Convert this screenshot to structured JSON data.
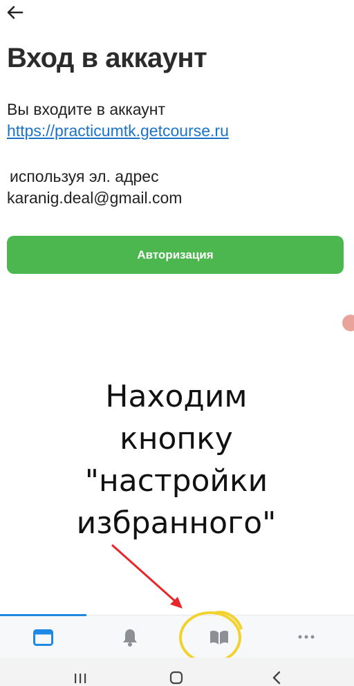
{
  "header": {
    "back_icon": "arrow-left-icon",
    "title": "Вход в аккаунт"
  },
  "info": {
    "line1": "Вы входите в аккаунт",
    "link": "https://practicumtk.getcourse.ru",
    "line2": "используя эл. адрес",
    "email": "karanig.deal@gmail.com"
  },
  "auth_button": {
    "label": "Авторизация",
    "color": "#4cb74f"
  },
  "annotation": {
    "lines": [
      "Находим",
      "кнопку",
      "\"настройки",
      "избранного\""
    ],
    "arrow_color": "#e8262a",
    "circle_color": "#f2d22e"
  },
  "tabbar": {
    "accent": "#1e88e5",
    "tabs": [
      {
        "icon": "browser-window-icon",
        "active": true
      },
      {
        "icon": "bell-icon",
        "active": false
      },
      {
        "icon": "book-icon",
        "active": false
      },
      {
        "icon": "more-dots-icon",
        "active": false
      }
    ]
  },
  "system_nav": {
    "icons": [
      "recent-apps-icon",
      "home-icon",
      "back-icon"
    ]
  }
}
